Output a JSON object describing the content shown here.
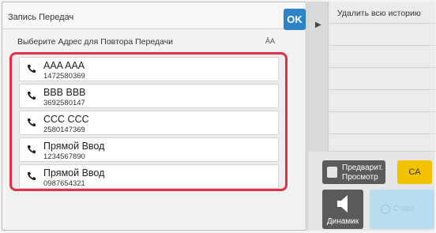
{
  "header": {
    "title": "Запись Передач",
    "ok_label": "OK"
  },
  "subtitle": "Выберите Адрес для Повтора Передачи",
  "font_size_icon": "Ā A",
  "entries": [
    {
      "name": "AAA AAA",
      "number": "1472580369"
    },
    {
      "name": "BBB BBB",
      "number": "3692580147"
    },
    {
      "name": "CCC CCC",
      "number": "2580147369"
    },
    {
      "name": "Прямой Ввод",
      "number": "1234567890"
    },
    {
      "name": "Прямой Ввод",
      "number": "0987654321"
    }
  ],
  "right_panel": {
    "arrow_glyph": "▶",
    "history_items": [
      "Удалить всю историю",
      "",
      "",
      "",
      "",
      "",
      ""
    ],
    "preview_line1": "Предварит.",
    "preview_line2": "Просмотр",
    "ca_label": "CA",
    "speaker_label": "Динамик",
    "start_label": "Старт"
  },
  "colors": {
    "ok_blue": "#2e82c8",
    "highlight_red": "#e0304a",
    "ca_yellow": "#f2c200",
    "start_light_blue": "#b9dcef"
  }
}
